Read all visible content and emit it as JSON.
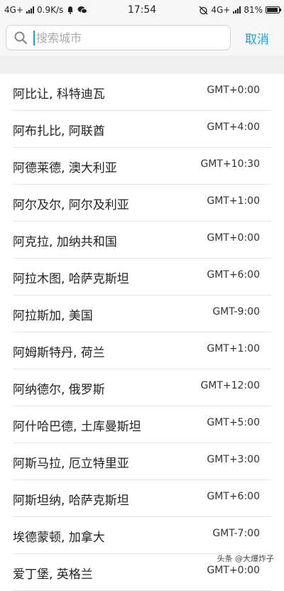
{
  "status_bar": {
    "network_left": "4G+",
    "speed": "0.9K/s",
    "time": "17:54",
    "network_right": "4G+",
    "battery": "81%"
  },
  "search": {
    "placeholder": "搜索城市",
    "cancel_label": "取消"
  },
  "cities": [
    {
      "name": "阿比让, 科特迪瓦",
      "tz": "GMT+0:00"
    },
    {
      "name": "阿布扎比, 阿联酋",
      "tz": "GMT+4:00"
    },
    {
      "name": "阿德莱德, 澳大利亚",
      "tz": "GMT+10:30"
    },
    {
      "name": "阿尔及尔, 阿尔及利亚",
      "tz": "GMT+1:00"
    },
    {
      "name": "阿克拉, 加纳共和国",
      "tz": "GMT+0:00"
    },
    {
      "name": "阿拉木图, 哈萨克斯坦",
      "tz": "GMT+6:00"
    },
    {
      "name": "阿拉斯加, 美国",
      "tz": "GMT-9:00"
    },
    {
      "name": "阿姆斯特丹, 荷兰",
      "tz": "GMT+1:00"
    },
    {
      "name": "阿纳德尔, 俄罗斯",
      "tz": "GMT+12:00"
    },
    {
      "name": "阿什哈巴德, 土库曼斯坦",
      "tz": "GMT+5:00"
    },
    {
      "name": "阿斯马拉, 厄立特里亚",
      "tz": "GMT+3:00"
    },
    {
      "name": "阿斯坦纳, 哈萨克斯坦",
      "tz": "GMT+6:00"
    },
    {
      "name": "埃德蒙顿, 加拿大",
      "tz": "GMT-7:00"
    },
    {
      "name": "爱丁堡, 英格兰",
      "tz": "GMT+0:00"
    }
  ],
  "watermark": "头条 @大爆炸子"
}
